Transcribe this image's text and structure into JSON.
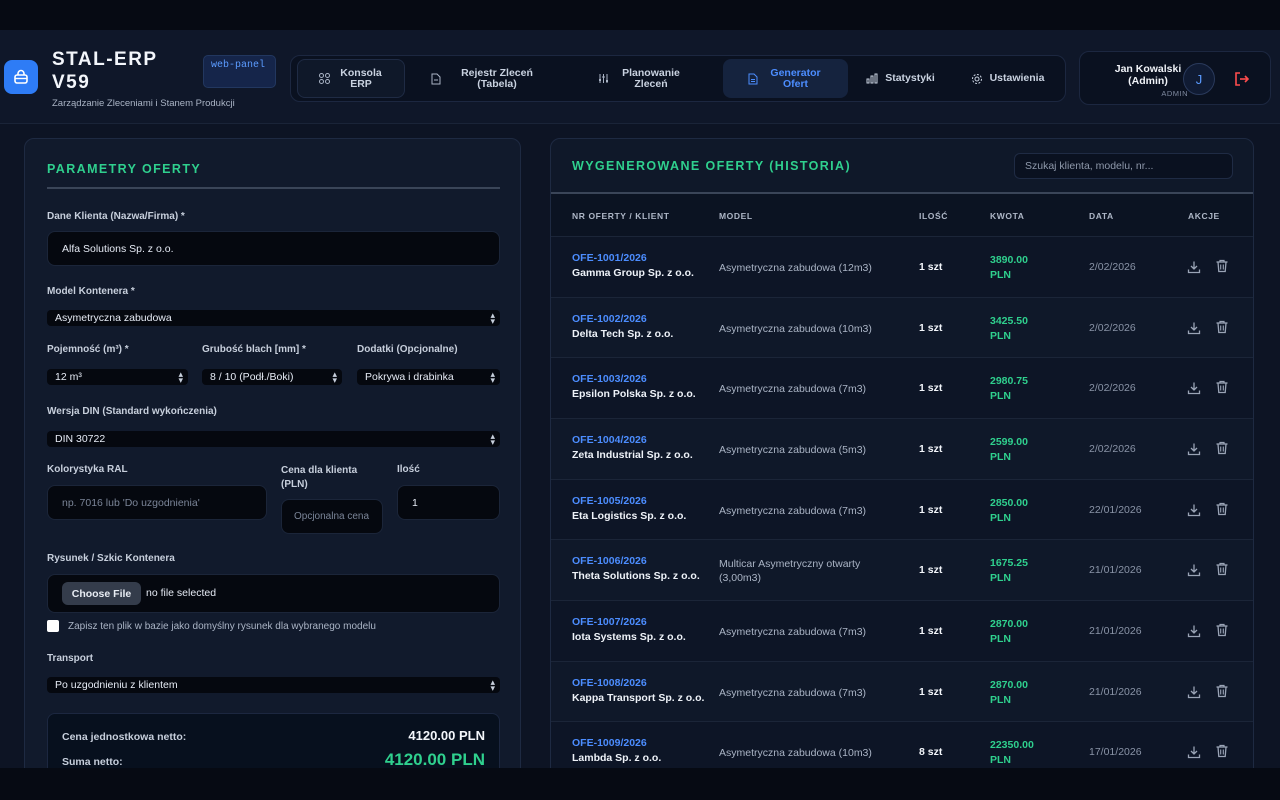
{
  "app": {
    "title": "STAL-ERP V59",
    "subtitle": "Zarządzanie Zleceniami i Stanem Produkcji",
    "badge": "web-panel"
  },
  "nav": {
    "items": [
      {
        "label": "Konsola ERP",
        "icon": "grid-icon"
      },
      {
        "label": "Rejestr Zleceń (Tabela)",
        "icon": "document-icon"
      },
      {
        "label": "Planowanie Zleceń",
        "icon": "sliders-icon"
      },
      {
        "label": "Generator Ofert",
        "icon": "file-text-icon"
      },
      {
        "label": "Statystyki",
        "icon": "bar-chart-icon"
      },
      {
        "label": "Ustawienia",
        "icon": "gear-icon"
      }
    ]
  },
  "user": {
    "name": "Jan Kowalski (Admin)",
    "role": "ADMIN",
    "initial": "J"
  },
  "form": {
    "title": "PARAMETRY OFERTY",
    "client_label": "Dane Klienta (Nazwa/Firma) *",
    "client_value": "Alfa Solutions Sp. z o.o.",
    "model_label": "Model Kontenera *",
    "model_value": "Asymetryczna zabudowa",
    "capacity_label": "Pojemność (m³) *",
    "capacity_value": "12 m³",
    "thickness_label": "Grubość blach [mm] *",
    "thickness_value": "8 / 10 (Podł./Boki)",
    "addons_label": "Dodatki (Opcjonalne)",
    "addons_value": "Pokrywa i drabinka",
    "din_label": "Wersja DIN (Standard wykończenia)",
    "din_value": "DIN 30722",
    "ral_label": "Kolorystyka RAL",
    "ral_placeholder": "np. 7016 lub 'Do uzgodnienia'",
    "price_label": "Cena dla klienta (PLN)",
    "price_placeholder": "Opcjonalna cena",
    "qty_label": "Ilość",
    "qty_value": "1",
    "drawing_label": "Rysunek / Szkic Kontenera",
    "file_button": "Choose File",
    "file_status": "no file selected",
    "save_default_label": "Zapisz ten plik w bazie jako domyślny rysunek dla wybranego modelu",
    "transport_label": "Transport",
    "transport_value": "Po uzgodnieniu z klientem",
    "unit_price_label": "Cena jednostkowa netto:",
    "unit_price_value": "4120.00 PLN",
    "net_sum_label": "Suma netto:",
    "net_sum_value": "4120.00 PLN"
  },
  "history": {
    "title": "WYGENEROWANE OFERTY (HISTORIA)",
    "search_placeholder": "Szukaj klienta, modelu, nr...",
    "columns": [
      "NR OFERTY / KLIENT",
      "MODEL",
      "ILOŚĆ",
      "KWOTA",
      "DATA",
      "AKCJE"
    ],
    "rows": [
      {
        "id": "OFE-1001/2026",
        "client": "Gamma Group Sp. z o.o.",
        "model": "Asymetryczna zabudowa (12m3)",
        "qty": "1 szt",
        "amount": "3890.00",
        "currency": "PLN",
        "date": "2/02/2026"
      },
      {
        "id": "OFE-1002/2026",
        "client": "Delta Tech Sp. z o.o.",
        "model": "Asymetryczna zabudowa (10m3)",
        "qty": "1 szt",
        "amount": "3425.50",
        "currency": "PLN",
        "date": "2/02/2026"
      },
      {
        "id": "OFE-1003/2026",
        "client": "Epsilon Polska Sp. z o.o.",
        "model": "Asymetryczna zabudowa (7m3)",
        "qty": "1 szt",
        "amount": "2980.75",
        "currency": "PLN",
        "date": "2/02/2026"
      },
      {
        "id": "OFE-1004/2026",
        "client": "Zeta Industrial Sp. z o.o.",
        "model": "Asymetryczna zabudowa (5m3)",
        "qty": "1 szt",
        "amount": "2599.00",
        "currency": "PLN",
        "date": "2/02/2026"
      },
      {
        "id": "OFE-1005/2026",
        "client": "Eta Logistics Sp. z o.o.",
        "model": "Asymetryczna zabudowa (7m3)",
        "qty": "1 szt",
        "amount": "2850.00",
        "currency": "PLN",
        "date": "22/01/2026"
      },
      {
        "id": "OFE-1006/2026",
        "client": "Theta Solutions Sp. z o.o.",
        "model": "Multicar Asymetryczny otwarty (3,00m3)",
        "qty": "1 szt",
        "amount": "1675.25",
        "currency": "PLN",
        "date": "21/01/2026"
      },
      {
        "id": "OFE-1007/2026",
        "client": "Iota Systems Sp. z o.o.",
        "model": "Asymetryczna zabudowa (7m3)",
        "qty": "1 szt",
        "amount": "2870.00",
        "currency": "PLN",
        "date": "21/01/2026"
      },
      {
        "id": "OFE-1008/2026",
        "client": "Kappa Transport Sp. z o.o.",
        "model": "Asymetryczna zabudowa (7m3)",
        "qty": "1 szt",
        "amount": "2870.00",
        "currency": "PLN",
        "date": "21/01/2026"
      },
      {
        "id": "OFE-1009/2026",
        "client": "Lambda Sp. z o.o.",
        "model": "Asymetryczna zabudowa (10m3)",
        "qty": "8 szt",
        "amount": "22350.00",
        "currency": "PLN",
        "date": "17/01/2026"
      }
    ]
  },
  "colors": {
    "accent_green": "#2fd08e",
    "accent_blue": "#4c8dff",
    "logout_red": "#ff4d4d"
  }
}
